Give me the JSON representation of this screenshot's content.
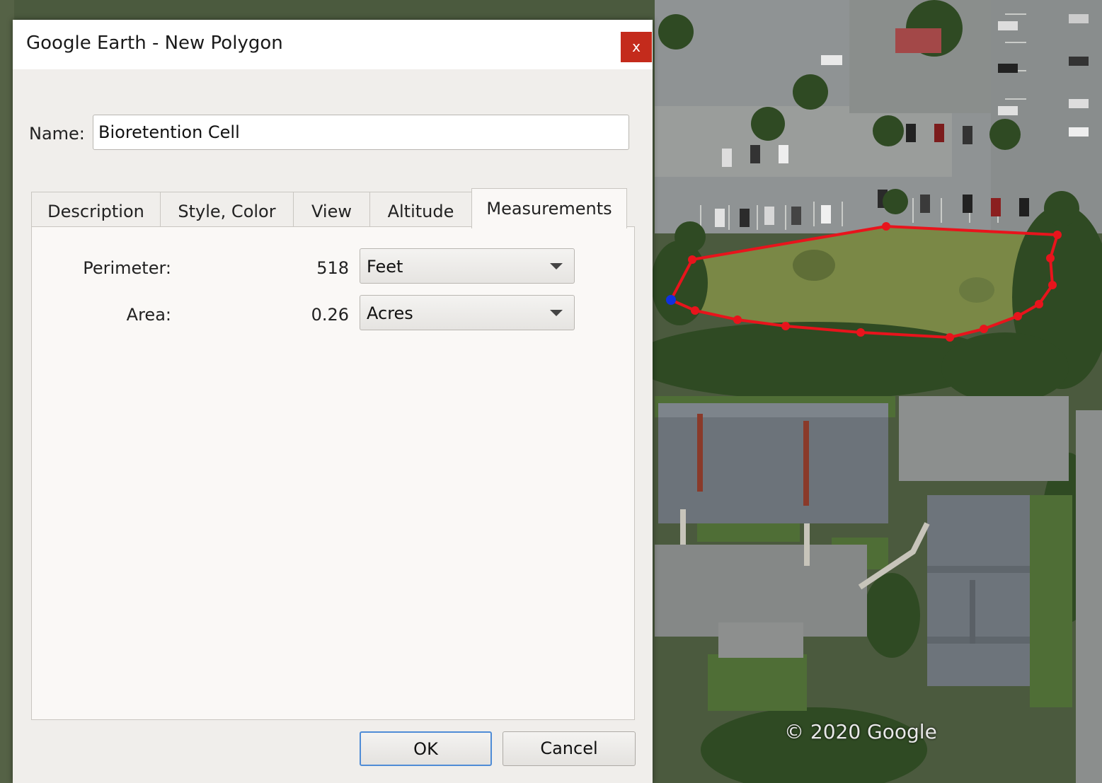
{
  "window": {
    "title": "Google Earth - New Polygon",
    "close_label": "x"
  },
  "name_field": {
    "label": "Name:",
    "value": "Bioretention Cell"
  },
  "tabs": [
    {
      "label": "Description"
    },
    {
      "label": "Style, Color"
    },
    {
      "label": "View"
    },
    {
      "label": "Altitude"
    },
    {
      "label": "Measurements",
      "active": true
    }
  ],
  "measurements": {
    "perimeter": {
      "label": "Perimeter:",
      "value": "518",
      "unit": "Feet"
    },
    "area": {
      "label": "Area:",
      "value": "0.26",
      "unit": "Acres"
    }
  },
  "buttons": {
    "ok": "OK",
    "cancel": "Cancel"
  },
  "map": {
    "copyright": "© 2020 Google",
    "polygon_color": "#e8141c",
    "start_vertex_color": "#1030e0"
  }
}
